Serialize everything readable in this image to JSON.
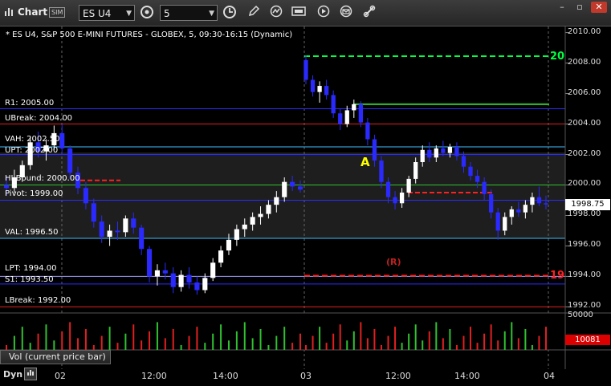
{
  "window": {
    "title": "Chart",
    "sim_badge": "SIM",
    "symbol": "ES U4",
    "interval": "5"
  },
  "chart_data": {
    "type": "candlestick",
    "subtitle": "* ES U4, S&P 500 E-MINI FUTURES - GLOBEX, 5, 09:30-16:15 (Dynamic)",
    "ylim": [
      1991.6,
      2010.4
    ],
    "y_ticks": [
      "2010.00",
      "2008.00",
      "2006.00",
      "2004.00",
      "2002.00",
      "2000.00",
      "1998.00",
      "1996.00",
      "1994.00",
      "1992.00"
    ],
    "x_ticks": [
      "02",
      "12:00",
      "14:00",
      "03",
      "12:00",
      "14:00",
      "04"
    ],
    "last_price": "1998.75",
    "levels": [
      {
        "label": "R1: 2005.00",
        "value": 2005.0,
        "color": "#2b2bff"
      },
      {
        "label": "UBreak: 2004.00",
        "value": 2004.0,
        "color": "#e02020"
      },
      {
        "label": "VAH: 2002.50",
        "value": 2002.5,
        "color": "#40c0ff"
      },
      {
        "label": "UPT: 2002.00",
        "value": 2002.0,
        "color": "#2b2bff"
      },
      {
        "label": "HI Bound: 2000.00",
        "value": 2000.0,
        "color": "#30c030"
      },
      {
        "label": "Pivot: 1999.00",
        "value": 1999.0,
        "color": "#2b2bff"
      },
      {
        "label": "VAL: 1996.50",
        "value": 1996.5,
        "color": "#40c0ff"
      },
      {
        "label": "LPT: 1994.00",
        "value": 1994.0,
        "color": "#a0a0ff"
      },
      {
        "label": "S1: 1993.50",
        "value": 1993.5,
        "color": "#2b2bff"
      },
      {
        "label": "LBreak: 1992.00",
        "value": 1992.0,
        "color": "#e02020"
      }
    ],
    "annotations": [
      {
        "text": "20",
        "value": 2008.45,
        "color": "#00ff40"
      },
      {
        "text": "19",
        "value": 1994.05,
        "color": "#ff2020"
      },
      {
        "text": "A",
        "value": 2001.5,
        "color": "#ffff00"
      },
      {
        "text": "(R)",
        "value": 1994.85,
        "color": "#c02020"
      }
    ],
    "candles_day1": [
      {
        "o": 2000.0,
        "h": 2000.6,
        "l": 1999.3,
        "c": 1999.8
      },
      {
        "o": 1999.8,
        "h": 2001.0,
        "l": 1999.5,
        "c": 2000.5
      },
      {
        "o": 2000.5,
        "h": 2001.6,
        "l": 2000.2,
        "c": 2001.3
      },
      {
        "o": 2001.3,
        "h": 2003.2,
        "l": 2001.0,
        "c": 2002.8
      },
      {
        "o": 2002.8,
        "h": 2003.5,
        "l": 2001.8,
        "c": 2002.2
      },
      {
        "o": 2002.2,
        "h": 2003.0,
        "l": 2001.6,
        "c": 2002.6
      },
      {
        "o": 2002.6,
        "h": 2003.9,
        "l": 2002.3,
        "c": 2003.4
      },
      {
        "o": 2003.4,
        "h": 2004.0,
        "l": 2002.0,
        "c": 2002.4
      },
      {
        "o": 2002.4,
        "h": 2002.6,
        "l": 2000.4,
        "c": 2000.8
      },
      {
        "o": 2000.8,
        "h": 2001.2,
        "l": 1999.4,
        "c": 1999.8
      },
      {
        "o": 1999.8,
        "h": 2000.2,
        "l": 1998.4,
        "c": 1998.8
      },
      {
        "o": 1998.8,
        "h": 1999.1,
        "l": 1997.2,
        "c": 1997.6
      },
      {
        "o": 1997.6,
        "h": 1998.0,
        "l": 1996.2,
        "c": 1996.6
      },
      {
        "o": 1996.6,
        "h": 1997.4,
        "l": 1996.0,
        "c": 1997.0
      },
      {
        "o": 1997.0,
        "h": 1997.6,
        "l": 1996.4,
        "c": 1996.9
      },
      {
        "o": 1996.9,
        "h": 1998.0,
        "l": 1996.6,
        "c": 1997.8
      },
      {
        "o": 1997.8,
        "h": 1998.2,
        "l": 1996.8,
        "c": 1997.2
      },
      {
        "o": 1997.2,
        "h": 1997.4,
        "l": 1995.4,
        "c": 1995.8
      },
      {
        "o": 1995.8,
        "h": 1996.0,
        "l": 1993.6,
        "c": 1994.0
      },
      {
        "o": 1994.0,
        "h": 1994.8,
        "l": 1993.4,
        "c": 1994.4
      },
      {
        "o": 1994.4,
        "h": 1994.9,
        "l": 1993.8,
        "c": 1994.2
      },
      {
        "o": 1994.2,
        "h": 1994.6,
        "l": 1992.9,
        "c": 1993.3
      },
      {
        "o": 1993.3,
        "h": 1994.4,
        "l": 1993.0,
        "c": 1994.1
      },
      {
        "o": 1994.1,
        "h": 1994.6,
        "l": 1993.2,
        "c": 1993.6
      },
      {
        "o": 1993.6,
        "h": 1994.0,
        "l": 1992.8,
        "c": 1993.1
      },
      {
        "o": 1993.1,
        "h": 1994.2,
        "l": 1992.9,
        "c": 1993.9
      },
      {
        "o": 1993.9,
        "h": 1995.2,
        "l": 1993.7,
        "c": 1994.9
      },
      {
        "o": 1994.9,
        "h": 1996.0,
        "l": 1994.6,
        "c": 1995.7
      },
      {
        "o": 1995.7,
        "h": 1996.8,
        "l": 1995.4,
        "c": 1996.4
      },
      {
        "o": 1996.4,
        "h": 1997.4,
        "l": 1996.0,
        "c": 1997.1
      },
      {
        "o": 1997.1,
        "h": 1997.8,
        "l": 1996.6,
        "c": 1997.4
      },
      {
        "o": 1997.4,
        "h": 1998.2,
        "l": 1997.0,
        "c": 1997.9
      },
      {
        "o": 1997.9,
        "h": 1998.6,
        "l": 1997.4,
        "c": 1998.1
      },
      {
        "o": 1998.1,
        "h": 1999.0,
        "l": 1997.8,
        "c": 1998.7
      },
      {
        "o": 1998.7,
        "h": 1999.6,
        "l": 1998.2,
        "c": 1999.2
      },
      {
        "o": 1999.2,
        "h": 2000.5,
        "l": 1998.9,
        "c": 2000.2
      },
      {
        "o": 2000.2,
        "h": 2000.6,
        "l": 1999.6,
        "c": 1999.9
      },
      {
        "o": 1999.9,
        "h": 2000.3,
        "l": 1999.5,
        "c": 1999.7
      }
    ],
    "candles_day2": [
      {
        "o": 2008.2,
        "h": 2008.5,
        "l": 2006.6,
        "c": 2006.9
      },
      {
        "o": 2006.9,
        "h": 2007.2,
        "l": 2005.8,
        "c": 2006.1
      },
      {
        "o": 2006.1,
        "h": 2006.8,
        "l": 2005.4,
        "c": 2006.5
      },
      {
        "o": 2006.5,
        "h": 2006.9,
        "l": 2005.6,
        "c": 2005.9
      },
      {
        "o": 2005.9,
        "h": 2006.2,
        "l": 2004.4,
        "c": 2004.7
      },
      {
        "o": 2004.7,
        "h": 2005.0,
        "l": 2003.6,
        "c": 2004.0
      },
      {
        "o": 2004.0,
        "h": 2005.2,
        "l": 2003.8,
        "c": 2004.9
      },
      {
        "o": 2004.9,
        "h": 2005.6,
        "l": 2004.4,
        "c": 2005.3
      },
      {
        "o": 2005.3,
        "h": 2005.5,
        "l": 2003.8,
        "c": 2004.1
      },
      {
        "o": 2004.1,
        "h": 2004.4,
        "l": 2002.6,
        "c": 2003.0
      },
      {
        "o": 2003.0,
        "h": 2003.3,
        "l": 2001.2,
        "c": 2001.6
      },
      {
        "o": 2001.6,
        "h": 2001.9,
        "l": 1999.8,
        "c": 2000.2
      },
      {
        "o": 2000.2,
        "h": 2000.5,
        "l": 1998.8,
        "c": 1999.2
      },
      {
        "o": 1999.2,
        "h": 1999.6,
        "l": 1998.4,
        "c": 1998.8
      },
      {
        "o": 1998.8,
        "h": 1999.8,
        "l": 1998.5,
        "c": 1999.5
      },
      {
        "o": 1999.5,
        "h": 2000.6,
        "l": 1999.2,
        "c": 2000.4
      },
      {
        "o": 2000.4,
        "h": 2001.8,
        "l": 2000.1,
        "c": 2001.5
      },
      {
        "o": 2001.5,
        "h": 2002.6,
        "l": 2001.2,
        "c": 2002.3
      },
      {
        "o": 2002.3,
        "h": 2002.8,
        "l": 2001.5,
        "c": 2001.8
      },
      {
        "o": 2001.8,
        "h": 2002.6,
        "l": 2001.5,
        "c": 2002.4
      },
      {
        "o": 2002.4,
        "h": 2002.9,
        "l": 2001.9,
        "c": 2002.1
      },
      {
        "o": 2002.1,
        "h": 2002.7,
        "l": 2001.8,
        "c": 2002.5
      },
      {
        "o": 2002.5,
        "h": 2002.8,
        "l": 2001.6,
        "c": 2001.9
      },
      {
        "o": 2001.9,
        "h": 2002.2,
        "l": 2000.8,
        "c": 2001.2
      },
      {
        "o": 2001.2,
        "h": 2001.5,
        "l": 2000.3,
        "c": 2000.6
      },
      {
        "o": 2000.6,
        "h": 2001.0,
        "l": 1999.8,
        "c": 2000.2
      },
      {
        "o": 2000.2,
        "h": 2000.5,
        "l": 1999.0,
        "c": 1999.4
      },
      {
        "o": 1999.4,
        "h": 1999.7,
        "l": 1997.8,
        "c": 1998.2
      },
      {
        "o": 1998.2,
        "h": 1998.5,
        "l": 1996.4,
        "c": 1997.0
      },
      {
        "o": 1997.0,
        "h": 1998.2,
        "l": 1996.7,
        "c": 1997.9
      },
      {
        "o": 1997.9,
        "h": 1998.6,
        "l": 1997.4,
        "c": 1998.4
      },
      {
        "o": 1998.4,
        "h": 1998.9,
        "l": 1997.9,
        "c": 1998.2
      },
      {
        "o": 1998.2,
        "h": 1999.0,
        "l": 1997.8,
        "c": 1998.7
      },
      {
        "o": 1998.7,
        "h": 1999.5,
        "l": 1998.2,
        "c": 1999.2
      },
      {
        "o": 1999.2,
        "h": 1999.9,
        "l": 1998.6,
        "c": 1998.8
      },
      {
        "o": 1998.8,
        "h": 1999.3,
        "l": 1998.4,
        "c": 1998.75
      }
    ],
    "volume": {
      "top_label": "50000",
      "last": "10081"
    }
  },
  "panels": {
    "volume_label": "Vol (current price bar)",
    "dyn_label": "Dyn"
  }
}
